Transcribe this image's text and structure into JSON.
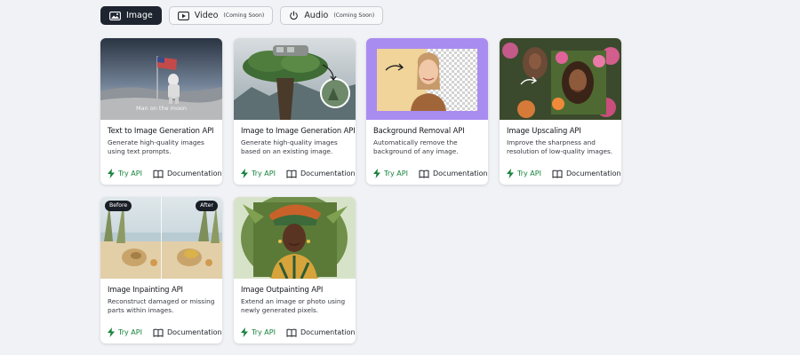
{
  "tabs": [
    {
      "label": "Image",
      "active": true
    },
    {
      "label": "Video",
      "note": "(Coming Soon)",
      "active": false
    },
    {
      "label": "Audio",
      "note": "(Coming Soon)",
      "active": false
    }
  ],
  "actions": {
    "try": "Try API",
    "docs": "Documentation"
  },
  "cards": [
    {
      "title": "Text to Image Generation API",
      "desc": "Generate high-quality images using text prompts.",
      "caption": "Man on the moon"
    },
    {
      "title": "Image to Image Generation API",
      "desc": "Generate high-quality images based on an existing image."
    },
    {
      "title": "Background Removal API",
      "desc": "Automatically remove the background of any image."
    },
    {
      "title": "Image Upscaling API",
      "desc": "Improve the sharpness and resolution of low-quality images."
    },
    {
      "title": "Image Inpainting API",
      "desc": "Reconstruct damaged or missing parts within images.",
      "before": "Before",
      "after": "After"
    },
    {
      "title": "Image Outpainting API",
      "desc": "Extend an image or photo using newly generated pixels."
    }
  ],
  "colors": {
    "accent_green": "#14823a",
    "active_tab": "#1e2430",
    "background": "#f1f2f5",
    "bg_removal_purple": "#a98cf0"
  }
}
